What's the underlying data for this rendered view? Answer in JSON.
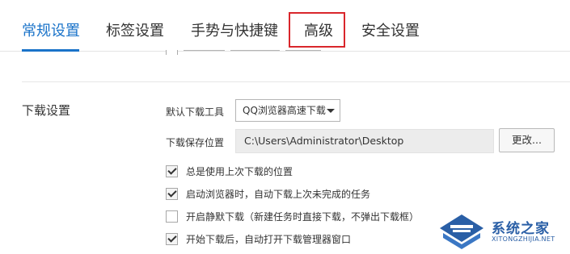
{
  "tabs": [
    {
      "label": "常规设置",
      "active": true
    },
    {
      "label": "标签设置",
      "active": false
    },
    {
      "label": "手势与快捷键",
      "active": false
    },
    {
      "label": "高级",
      "active": false
    },
    {
      "label": "安全设置",
      "active": false
    }
  ],
  "colors": {
    "accent": "#1a73c9",
    "highlight": "#d9262b"
  },
  "download": {
    "section_title": "下载设置",
    "default_tool_label": "默认下载工具",
    "default_tool_value": "QQ浏览器高速下载",
    "save_path_label": "下载保存位置",
    "save_path_value": "C:\\Users\\Administrator\\Desktop",
    "change_button": "更改...",
    "options": [
      {
        "label": "总是使用上次下载的位置",
        "checked": true
      },
      {
        "label": "启动浏览器时，自动下载上次未完成的任务",
        "checked": true
      },
      {
        "label": "开启静默下载（新建任务时直接下载，不弹出下载框）",
        "checked": false
      },
      {
        "label": "开始下载后，自动打开下载管理器窗口",
        "checked": true
      }
    ]
  },
  "watermark": {
    "title": "系统之家",
    "subtitle": "XITONGZHIJIA.NET"
  }
}
